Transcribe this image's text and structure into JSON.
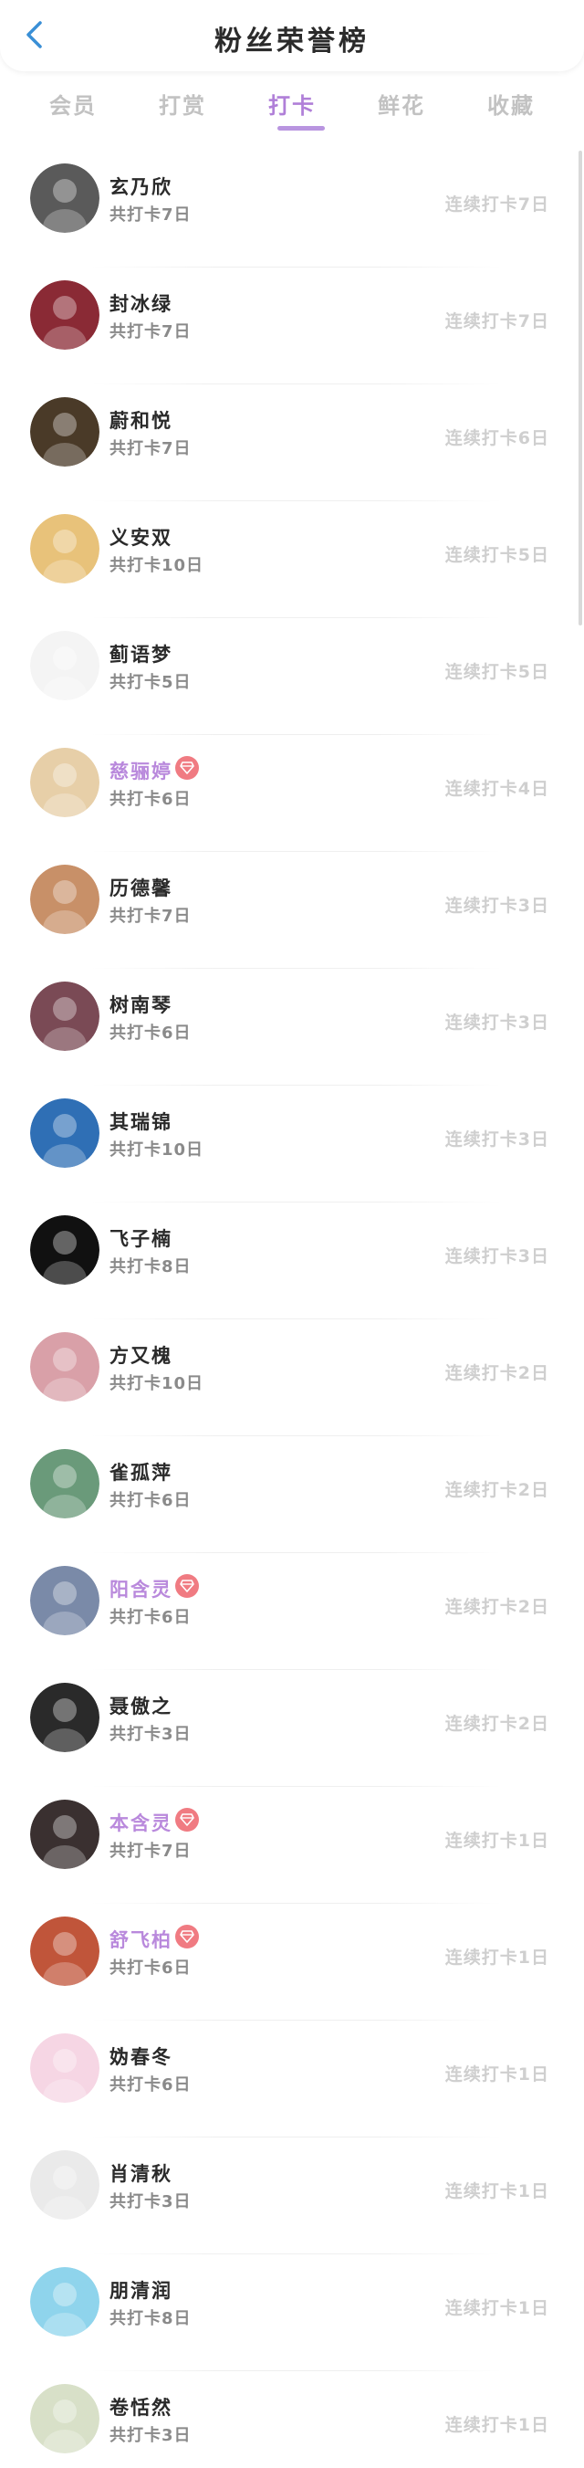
{
  "header": {
    "title": "粉丝荣誉榜",
    "back_icon": "chevron-left-icon",
    "accent": "#3a8fd6"
  },
  "tabs": [
    {
      "label": "会员",
      "active": false
    },
    {
      "label": "打赏",
      "active": false
    },
    {
      "label": "打卡",
      "active": true
    },
    {
      "label": "鲜花",
      "active": false
    },
    {
      "label": "收藏",
      "active": false
    }
  ],
  "colors": {
    "active_tab": "#b07fd8",
    "vip_name": "#b989dc",
    "vip_badge": "#f07b82",
    "streak_text": "#cfcfcf"
  },
  "fans": [
    {
      "name": "玄乃欣",
      "total": "共打卡7日",
      "streak": "连续打卡7日",
      "vip": false,
      "avatar_bg": "#5a5a5a"
    },
    {
      "name": "封冰绿",
      "total": "共打卡7日",
      "streak": "连续打卡7日",
      "vip": false,
      "avatar_bg": "#8a2a35"
    },
    {
      "name": "蔚和悦",
      "total": "共打卡7日",
      "streak": "连续打卡6日",
      "vip": false,
      "avatar_bg": "#4a3a28"
    },
    {
      "name": "义安双",
      "total": "共打卡10日",
      "streak": "连续打卡5日",
      "vip": false,
      "avatar_bg": "#e8c27a"
    },
    {
      "name": "蓟语梦",
      "total": "共打卡5日",
      "streak": "连续打卡5日",
      "vip": false,
      "avatar_bg": "#f4f4f4"
    },
    {
      "name": "慈骊婷",
      "total": "共打卡6日",
      "streak": "连续打卡4日",
      "vip": true,
      "avatar_bg": "#e7cfa8"
    },
    {
      "name": "历德馨",
      "total": "共打卡7日",
      "streak": "连续打卡3日",
      "vip": false,
      "avatar_bg": "#c89068"
    },
    {
      "name": "树南琴",
      "total": "共打卡6日",
      "streak": "连续打卡3日",
      "vip": false,
      "avatar_bg": "#7a4a55"
    },
    {
      "name": "其瑞锦",
      "total": "共打卡10日",
      "streak": "连续打卡3日",
      "vip": false,
      "avatar_bg": "#2f6fb5"
    },
    {
      "name": "飞子楠",
      "total": "共打卡8日",
      "streak": "连续打卡3日",
      "vip": false,
      "avatar_bg": "#111111"
    },
    {
      "name": "方又槐",
      "total": "共打卡10日",
      "streak": "连续打卡2日",
      "vip": false,
      "avatar_bg": "#d9a0a8"
    },
    {
      "name": "雀孤萍",
      "total": "共打卡6日",
      "streak": "连续打卡2日",
      "vip": false,
      "avatar_bg": "#6a9a7a"
    },
    {
      "name": "阳含灵",
      "total": "共打卡6日",
      "streak": "连续打卡2日",
      "vip": true,
      "avatar_bg": "#7a8aa8"
    },
    {
      "name": "聂傲之",
      "total": "共打卡3日",
      "streak": "连续打卡2日",
      "vip": false,
      "avatar_bg": "#2a2a2a"
    },
    {
      "name": "本含灵",
      "total": "共打卡7日",
      "streak": "连续打卡1日",
      "vip": true,
      "avatar_bg": "#3a3030"
    },
    {
      "name": "舒飞柏",
      "total": "共打卡6日",
      "streak": "连续打卡1日",
      "vip": true,
      "avatar_bg": "#c0553a"
    },
    {
      "name": "妫春冬",
      "total": "共打卡6日",
      "streak": "连续打卡1日",
      "vip": false,
      "avatar_bg": "#f6d6e4"
    },
    {
      "name": "肖清秋",
      "total": "共打卡3日",
      "streak": "连续打卡1日",
      "vip": false,
      "avatar_bg": "#eaeaea"
    },
    {
      "name": "朋清润",
      "total": "共打卡8日",
      "streak": "连续打卡1日",
      "vip": false,
      "avatar_bg": "#8fd4ec"
    },
    {
      "name": "卷恬然",
      "total": "共打卡3日",
      "streak": "连续打卡1日",
      "vip": false,
      "avatar_bg": "#d8e0c8"
    }
  ]
}
